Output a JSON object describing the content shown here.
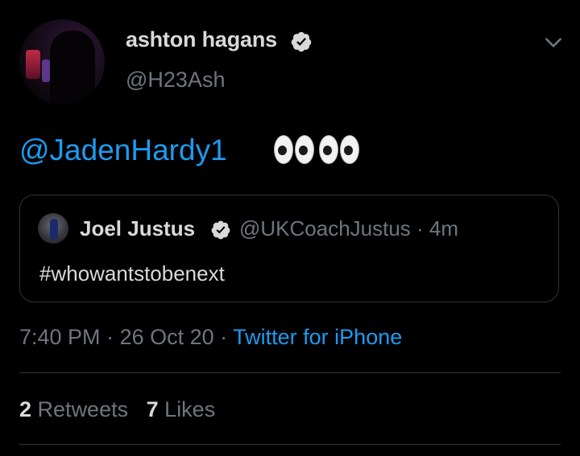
{
  "author": {
    "name": "ashton hagans",
    "handle": "@H23Ash"
  },
  "tweet": {
    "mention": "@JadenHardy1"
  },
  "quoted": {
    "name": "Joel Justus",
    "handle": "@UKCoachJustus",
    "separator": " · ",
    "age": "4m",
    "text": "#whowantstobenext"
  },
  "meta": {
    "time": "7:40 PM",
    "sep1": " · ",
    "date": "26 Oct 20",
    "sep2": " · ",
    "source": "Twitter for iPhone"
  },
  "stats": {
    "retweets_count": "2",
    "retweets_label": "Retweets",
    "likes_count": "7",
    "likes_label": "Likes"
  },
  "icons": {
    "verified": "verified-badge-icon",
    "menu": "chevron-down-icon",
    "emoji": "eyes-emoji"
  },
  "colors": {
    "background": "#000000",
    "accent": "#1d9bf0",
    "muted": "#6e767d",
    "border": "#2f3336"
  }
}
